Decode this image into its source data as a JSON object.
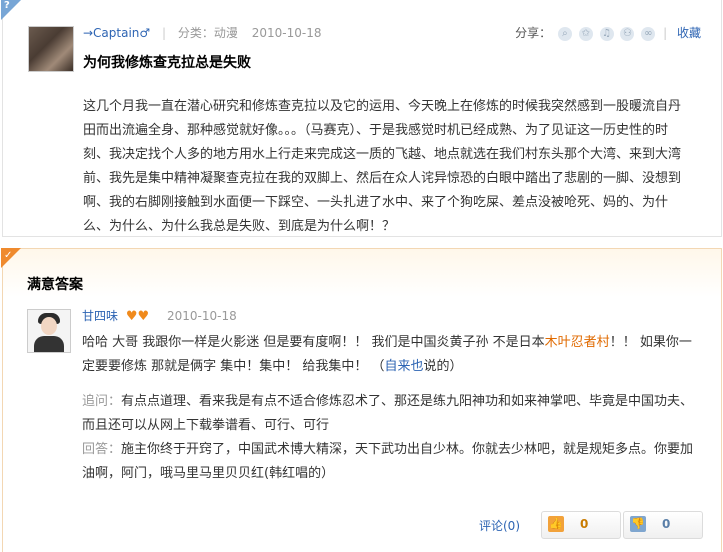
{
  "question": {
    "username": "→Captain♂",
    "category": "分类：动漫",
    "date": "2010-10-18",
    "title": "为何我修炼查克拉总是失败",
    "body": "这几个月我一直在潜心研究和修炼查克拉以及它的运用、今天晚上在修炼的时候我突然感到一股暖流自丹田而出流遍全身、那种感觉就好像。。。（马赛克）、于是我感觉时机已经成熟、为了见证这一历史性的时刻、我决定找个人多的地方用水上行走来完成这一质的飞越、地点就选在我们村东头那个大湾、来到大湾前、我先是集中精神凝聚查克拉在我的双脚上、然后在众人诧异惊恐的白眼中踏出了悲剧的一脚、没想到啊、我的右脚刚接触到水面便一下踩空、一头扎进了水中、来了个狗吃屎、差点没被呛死、妈的、为什么、为什么、为什么我总是失败、到底是为什么啊！？"
  },
  "share": {
    "label": "分享：",
    "icons": [
      "search-icon",
      "star-icon",
      "bell-icon",
      "user-icon",
      "weibo-icon"
    ],
    "glyphs": [
      "⌕",
      "✩",
      "♫",
      "⚇",
      "∞"
    ],
    "collect_label": "收藏"
  },
  "answer": {
    "header": "满意答案",
    "username": "甘四味",
    "hearts": "♥♥",
    "date": "2010-10-18",
    "body_part1": "哈哈 大哥 我跟你一样是火影迷 但是要有度啊！！ 我们是中国炎黄子孙 不是日本",
    "body_link1": "木叶忍者村",
    "body_part2": "！！ 如果你一定要要修炼 那就是俩字 集中！集中！ 给我集中！ （",
    "body_link2": "自来也",
    "body_part3": "说的）",
    "followup_label": "追问：",
    "followup_text": "有点点道理、看来我是有点不适合修炼忍术了、那还是练九阳神功和如来神掌吧、毕竟是中国功夫、而且还可以从网上下载拳谱看、可行、可行",
    "reply_label": "回答：",
    "reply_text": "施主你终于开窍了，中国武术博大精深，天下武功出自少林。你就去少林吧，就是规矩多点。你要加油啊，阿门，哦马里马里贝贝红(韩红唱的）",
    "comment_label": "评论(0)",
    "upvote_count": "0",
    "downvote_count": "0",
    "upvote_glyph": "👍",
    "downvote_glyph": "👎"
  }
}
